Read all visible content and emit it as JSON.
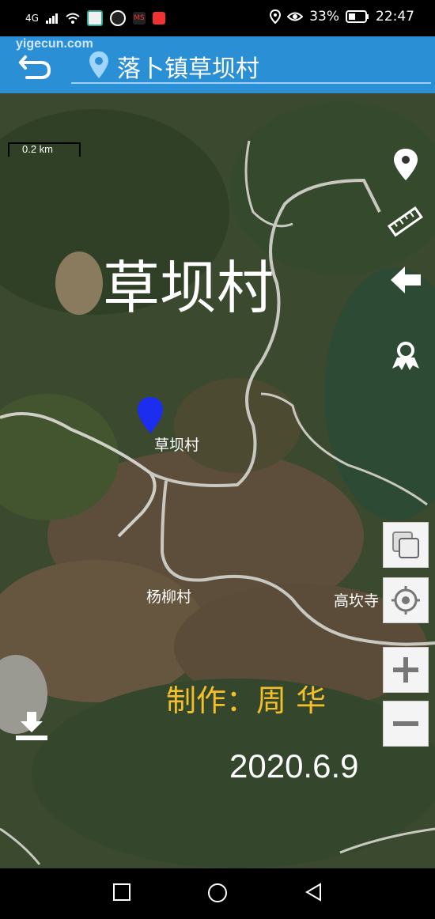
{
  "status_bar": {
    "network": "4G",
    "battery": "33%",
    "time": "22:47"
  },
  "header": {
    "watermark": "yigecun.com",
    "location": "落卜镇草坝村"
  },
  "map": {
    "scale": "0.2 km",
    "big_label": "草坝村",
    "place_labels": {
      "marker": "草坝村",
      "village2": "杨柳村",
      "village3": "高坎寺"
    },
    "author": "制作：周 华",
    "date": "2020.6.9"
  },
  "colors": {
    "header": "#2b8fd6",
    "marker": "#1b2ef0",
    "author_text": "#f3c02a"
  },
  "icons": [
    "back-arrow-icon",
    "location-pin-icon",
    "place-pin-icon",
    "ruler-icon",
    "arrow-left-icon",
    "route-icon",
    "layers-icon",
    "locate-icon",
    "zoom-in-icon",
    "zoom-out-icon",
    "download-icon"
  ]
}
